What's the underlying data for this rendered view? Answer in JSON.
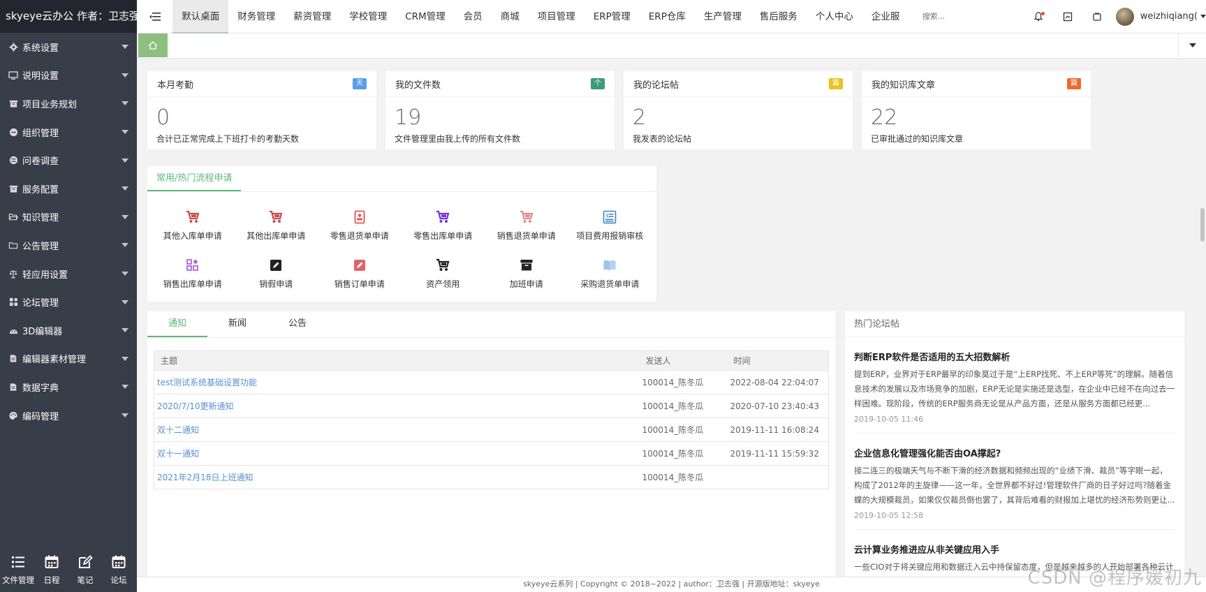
{
  "brand": "skyeye云办公 作者：卫志强",
  "sidebar": {
    "items": [
      {
        "label": "系统设置",
        "icon": "gear-icon"
      },
      {
        "label": "说明设置",
        "icon": "monitor-icon"
      },
      {
        "label": "项目业务规划",
        "icon": "archive-icon"
      },
      {
        "label": "组织管理",
        "icon": "circle-icon"
      },
      {
        "label": "问卷调查",
        "icon": "circle-lines-icon"
      },
      {
        "label": "服务配置",
        "icon": "archive-icon"
      },
      {
        "label": "知识管理",
        "icon": "folder-open-icon"
      },
      {
        "label": "公告管理",
        "icon": "folder-icon"
      },
      {
        "label": "轻应用设置",
        "icon": "scale-icon"
      },
      {
        "label": "论坛管理",
        "icon": "puzzle-icon"
      },
      {
        "label": "3D编辑器",
        "icon": "dome-icon"
      },
      {
        "label": "编辑器素材管理",
        "icon": "file-icon"
      },
      {
        "label": "数据字典",
        "icon": "file-icon"
      },
      {
        "label": "编码管理",
        "icon": "palette-icon"
      }
    ],
    "bottom": [
      {
        "label": "文件管理",
        "icon": "list-icon"
      },
      {
        "label": "日程",
        "icon": "calendar-icon"
      },
      {
        "label": "笔记",
        "icon": "edit-icon"
      },
      {
        "label": "论坛",
        "icon": "calendar-icon"
      }
    ]
  },
  "topnav": {
    "items": [
      "默认桌面",
      "财务管理",
      "薪资管理",
      "学校管理",
      "CRM管理",
      "会员",
      "商城",
      "项目管理",
      "ERP管理",
      "ERP仓库",
      "生产管理",
      "售后服务",
      "个人中心",
      "企业服"
    ],
    "active_index": 0,
    "search_placeholder": "搜索...",
    "username": "weizhiqiang("
  },
  "stats": [
    {
      "title": "本月考勤",
      "badge": "天",
      "badge_color": "#5b9bec",
      "value": "0",
      "desc": "合计已正常完成上下班打卡的考勤天数"
    },
    {
      "title": "我的文件数",
      "badge": "个",
      "badge_color": "#3e9b78",
      "value": "19",
      "desc": "文件管理里由我上传的所有文件数"
    },
    {
      "title": "我的论坛帖",
      "badge": "篇",
      "badge_color": "#f0c020",
      "value": "2",
      "desc": "我发表的论坛帖"
    },
    {
      "title": "我的知识库文章",
      "badge": "篇",
      "badge_color": "#ee6b2e",
      "value": "22",
      "desc": "已审批通过的知识库文章"
    }
  ],
  "flow": {
    "tab": "常用/热门流程申请",
    "items": [
      {
        "label": "其他入库单申请",
        "icon": "cart-icon",
        "color": "#c94c4c"
      },
      {
        "label": "其他出库单申请",
        "icon": "cart-icon",
        "color": "#c94c4c"
      },
      {
        "label": "零售退货单申请",
        "icon": "id-card-icon",
        "color": "#e05555"
      },
      {
        "label": "零售出库单申请",
        "icon": "cart-icon",
        "color": "#7b2fd6"
      },
      {
        "label": "销售退货单申请",
        "icon": "cart-icon",
        "color": "#e48a8a"
      },
      {
        "label": "项目费用报销审核",
        "icon": "receipt-icon",
        "color": "#3b82c4"
      },
      {
        "label": "销售出库单申请",
        "icon": "apps-icon",
        "color": "#b066d8"
      },
      {
        "label": "销假申请",
        "icon": "pencil-square-icon",
        "color": "#222222"
      },
      {
        "label": "销售订单申请",
        "icon": "pencil-square-icon",
        "color": "#e06666"
      },
      {
        "label": "资产领用",
        "icon": "cart-icon",
        "color": "#222222"
      },
      {
        "label": "加班申请",
        "icon": "box-icon",
        "color": "#222222"
      },
      {
        "label": "采购退货单申请",
        "icon": "book-icon",
        "color": "#9cc4e8"
      }
    ]
  },
  "notices": {
    "tabs": [
      "通知",
      "新闻",
      "公告"
    ],
    "active_tab": 0,
    "columns": [
      "主题",
      "发送人",
      "时间"
    ],
    "rows": [
      {
        "subject": "test测试系统基础设置功能",
        "sender": "100014_陈冬瓜",
        "time": "2022-08-04 22:04:07"
      },
      {
        "subject": "2020/7/10更新通知",
        "sender": "100014_陈冬瓜",
        "time": "2020-07-10 23:40:43"
      },
      {
        "subject": "双十二通知",
        "sender": "100014_陈冬瓜",
        "time": "2019-11-11 16:08:24"
      },
      {
        "subject": "双十一通知",
        "sender": "100014_陈冬瓜",
        "time": "2019-11-11 15:59:32"
      },
      {
        "subject": "2021年2月18日上班通知",
        "sender": "100014_陈冬瓜",
        "time": ""
      }
    ]
  },
  "forum": {
    "title": "热门论坛帖",
    "posts": [
      {
        "title": "判断ERP软件是否适用的五大招数解析",
        "body": "提到ERP，业界对于ERP最早的印象莫过于是“上ERP找死、不上ERP等死”的理解。随着信息技术的发展以及市场竞争的加剧，ERP无论是实施还是选型，在企业中已经不在向过去一样困难。现阶段，传统的ERP服务商无论是从产品方面，还是从服务方面都已经更...",
        "date": "2019-10-05 11:46"
      },
      {
        "title": "企业信息化管理强化能否由OA撑起?",
        "body": "接二连三的极端天气与不断下滑的经济数据和频频出现的“业绩下滑、裁员”等字眼一起，构成了2012年的主旋律——这一年，全世界都不好过!管理软件厂商的日子好过吗?随着金蝶的大规模裁员，如果仅仅裁员倒也罢了，其背后难看的财报加上堪忧的经济形势则更让...",
        "date": "2019-10-05 12:58"
      },
      {
        "title": "云计算业务推进应从非关键应用入手",
        "body": "一些CIO对于将关键应用和数据迁入云中持保留态度，但是越来越多的人开始部署各种云计算应用，以此期望获得成功的应用示范和经验...",
        "date": ""
      }
    ]
  },
  "footer": "skyeye云系列 | Copyright © 2018~2022 | author：卫志强 | 开源版地址：skyeye",
  "watermark": "CSDN @程序媛初九"
}
